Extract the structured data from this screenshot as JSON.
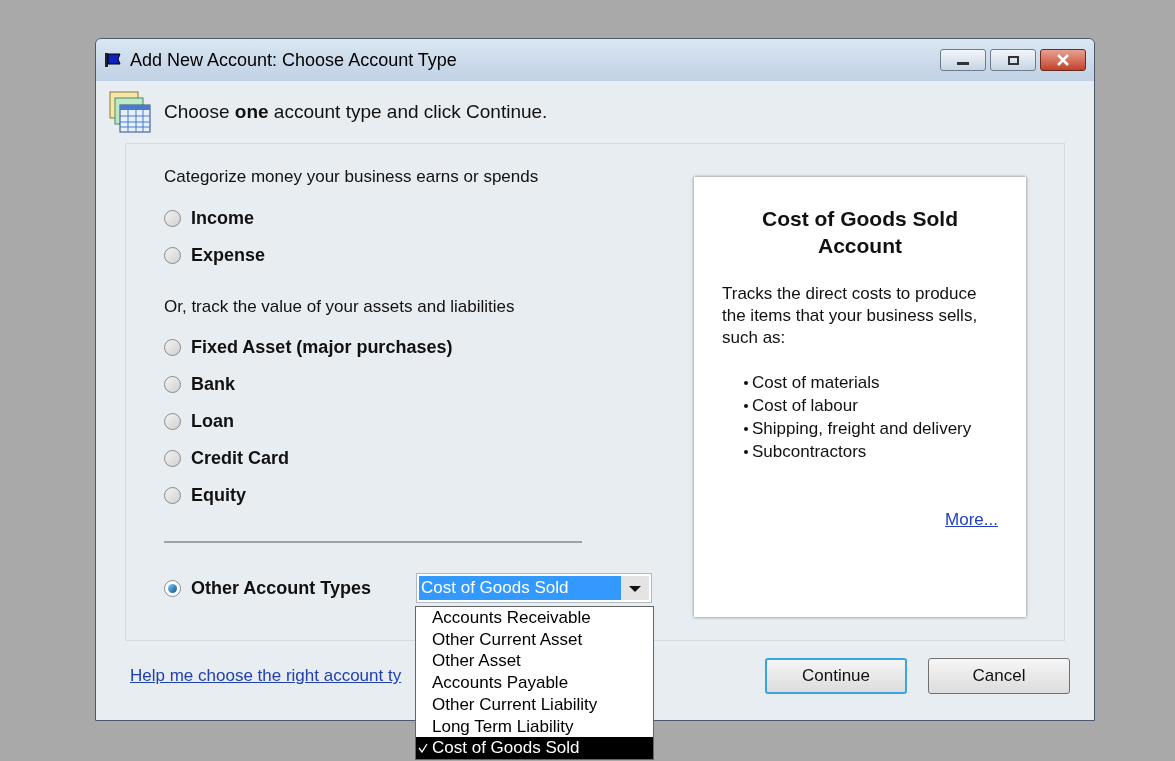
{
  "window": {
    "title": "Add New Account: Choose Account Type"
  },
  "instruction": "Choose **one** account type and click Continue.",
  "sections": [
    {
      "heading": "Categorize money your business earns or spends",
      "options": [
        {
          "label": "Income",
          "selected": false
        },
        {
          "label": "Expense",
          "selected": false
        }
      ]
    },
    {
      "heading": "Or, track the value of your assets and liabilities",
      "options": [
        {
          "label": "Fixed Asset (major purchases)",
          "selected": false
        },
        {
          "label": "Bank",
          "selected": false
        },
        {
          "label": "Loan",
          "selected": false
        },
        {
          "label": "Credit Card",
          "selected": false
        },
        {
          "label": "Equity",
          "selected": false
        }
      ]
    }
  ],
  "other": {
    "label": "Other Account Types",
    "selected": true,
    "dropdown": {
      "value": "Cost of Goods Sold",
      "expanded": true,
      "items": [
        {
          "label": "Accounts Receivable",
          "selected": false
        },
        {
          "label": "Other Current Asset",
          "selected": false
        },
        {
          "label": "Other Asset",
          "selected": false
        },
        {
          "label": "Accounts Payable",
          "selected": false
        },
        {
          "label": "Other Current Liability",
          "selected": false
        },
        {
          "label": "Long Term Liability",
          "selected": false
        },
        {
          "label": "Cost of Goods Sold",
          "selected": true
        }
      ]
    }
  },
  "info": {
    "title": "Cost of Goods Sold Account",
    "description": "Tracks the direct costs to produce the items that your business sells, such as:",
    "bullets": [
      "Cost of materials",
      "Cost of labour",
      "Shipping, freight and delivery",
      "Subcontractors"
    ],
    "more_link": "More..."
  },
  "help_link": "Help me choose the right account ty",
  "buttons": [
    {
      "label": "Continue",
      "kind": "default"
    },
    {
      "label": "Cancel",
      "kind": "normal"
    }
  ]
}
